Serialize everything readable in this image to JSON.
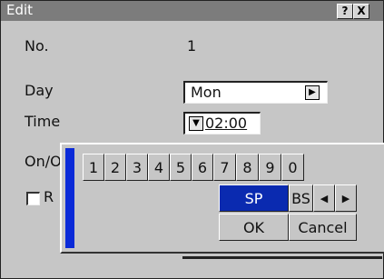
{
  "window": {
    "title": "Edit"
  },
  "titlebar": {
    "help": "?",
    "close": "X"
  },
  "form": {
    "no_label": "No.",
    "no_value": "1",
    "day_label": "Day",
    "day_value": "Mon",
    "time_label": "Time",
    "time_value": "02:00",
    "onoff_label": "On/O",
    "repeat_label": "R"
  },
  "keyboard": {
    "digits": [
      "1",
      "2",
      "3",
      "4",
      "5",
      "6",
      "7",
      "8",
      "9",
      "0"
    ],
    "sp": "SP",
    "bs": "BS",
    "left": "◀",
    "right": "▶",
    "ok": "OK",
    "cancel": "Cancel"
  },
  "colors": {
    "accent": "#0a2ad8",
    "selected_key": "#0a2ab0"
  }
}
